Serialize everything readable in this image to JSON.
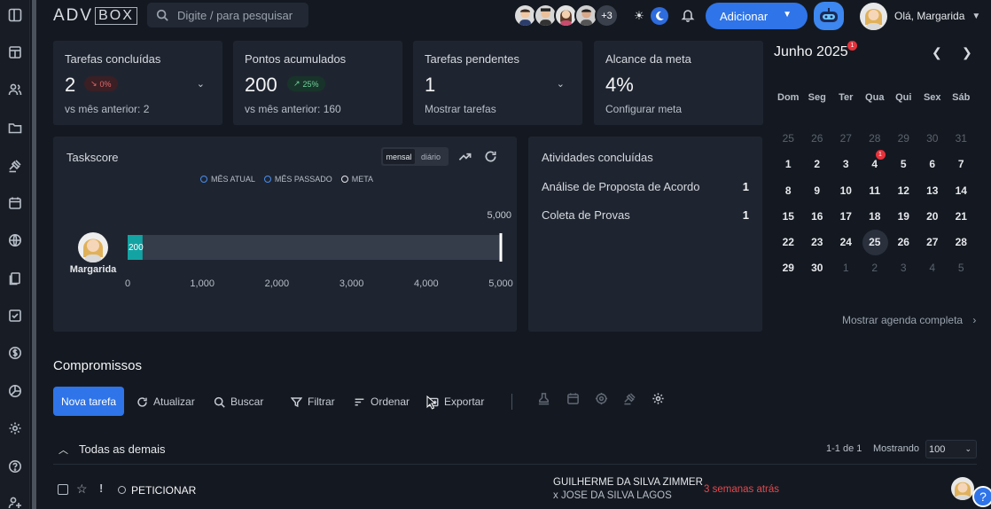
{
  "app": {
    "logo_adv": "ADV",
    "logo_box": "BOX"
  },
  "search": {
    "placeholder": "Digite / para pesquisar"
  },
  "header": {
    "avatars_more": "+3",
    "add_button": "Adicionar",
    "greeting": "Olá, Margarida"
  },
  "stats": [
    {
      "title": "Tarefas concluídas",
      "value": "2",
      "badge": "0%",
      "badge_trend": "down",
      "sub": "vs mês anterior: 2"
    },
    {
      "title": "Pontos acumulados",
      "value": "200",
      "badge": "25%",
      "badge_trend": "up",
      "sub": "vs mês anterior: 160"
    },
    {
      "title": "Tarefas pendentes",
      "value": "1",
      "sub": "Mostrar tarefas"
    },
    {
      "title": "Alcance da meta",
      "value": "4%",
      "sub": "Configurar meta"
    }
  ],
  "taskscore": {
    "title": "Taskscore",
    "toggle": [
      "mensal",
      "diário"
    ],
    "legend": [
      "MÊS ATUAL",
      "MÊS PASSADO",
      "META"
    ],
    "user_name": "Margarida"
  },
  "chart_data": {
    "type": "bar",
    "orientation": "horizontal",
    "categories": [
      "Margarida"
    ],
    "values": [
      200
    ],
    "goal": 5000,
    "goal_label": "5,000",
    "xlim": [
      0,
      5000
    ],
    "xticks": [
      "0",
      "1,000",
      "2,000",
      "3,000",
      "4,000",
      "5,000"
    ],
    "bar_label": "200",
    "colors": {
      "bar": "#14a3a3",
      "track": "#353d4b",
      "goal": "#ffffff"
    }
  },
  "activities": {
    "title": "Atividades concluídas",
    "items": [
      {
        "label": "Análise de Proposta de Acordo",
        "count": "1"
      },
      {
        "label": "Coleta de Provas",
        "count": "1"
      }
    ]
  },
  "calendar": {
    "title": "Junho 2025",
    "title_badge": "1",
    "weekdays": [
      "Dom",
      "Seg",
      "Ter",
      "Qua",
      "Qui",
      "Sex",
      "Sáb"
    ],
    "weeks": [
      [
        "25",
        "26",
        "27",
        "28",
        "29",
        "30",
        "31"
      ],
      [
        "1",
        "2",
        "3",
        "4",
        "5",
        "6",
        "7"
      ],
      [
        "8",
        "9",
        "10",
        "11",
        "12",
        "13",
        "14"
      ],
      [
        "15",
        "16",
        "17",
        "18",
        "19",
        "20",
        "21"
      ],
      [
        "22",
        "23",
        "24",
        "25",
        "26",
        "27",
        "28"
      ],
      [
        "29",
        "30",
        "1",
        "2",
        "3",
        "4",
        "5"
      ]
    ],
    "day_badge": "1",
    "show_full": "Mostrar agenda completa"
  },
  "compromissos": {
    "title": "Compromissos",
    "new_task": "Nova tarefa",
    "toolbar": [
      "Atualizar",
      "Buscar",
      "Filtrar",
      "Ordenar",
      "Exportar"
    ],
    "group_name": "Todas as demais",
    "pager": "1-1 de 1",
    "showing_label": "Mostrando",
    "per_page": "100",
    "task": {
      "name": "PETICIONAR",
      "party1": "GUILHERME DA SILVA ZIMMER",
      "party2": "x JOSE DA SILVA LAGOS",
      "when": "3 semanas atrás"
    }
  },
  "help": "?"
}
